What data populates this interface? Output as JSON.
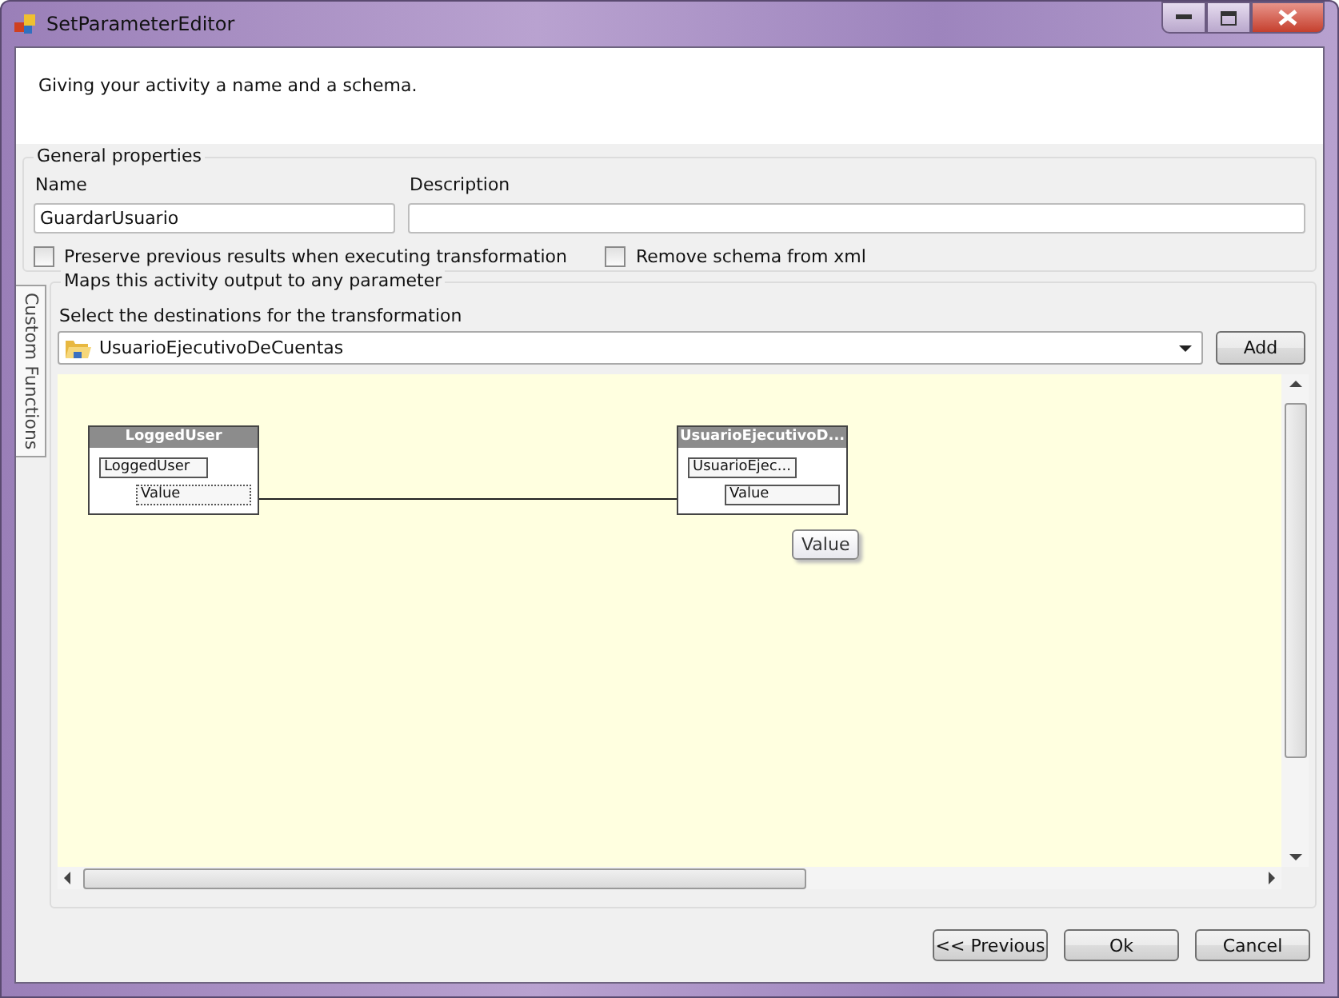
{
  "window": {
    "title": "SetParameterEditor"
  },
  "header": {
    "text": "Giving your activity a name and a schema."
  },
  "general": {
    "title": "General properties",
    "name_label": "Name",
    "name_value": "GuardarUsuario",
    "description_label": "Description",
    "checkboxes": [
      {
        "label": "Preserve previous results when executing transformation",
        "checked": false
      },
      {
        "label": "Remove schema from xml",
        "checked": false
      }
    ]
  },
  "side_tab": {
    "label": "Custom Functions"
  },
  "mapping": {
    "title": "Maps this activity output to any parameter",
    "select_label": "Select the destinations for the transformation",
    "destination": "UsuarioEjecutivoDeCuentas",
    "add_button": "Add",
    "source_node": {
      "title": "LoggedUser",
      "items": [
        "LoggedUser",
        "Value"
      ]
    },
    "target_node": {
      "title": "UsuarioEjecutivoD...",
      "items": [
        "UsuarioEjec...",
        "Value"
      ]
    },
    "tooltip": "Value"
  },
  "buttons": [
    "<< Previous",
    "Ok",
    "Cancel"
  ]
}
